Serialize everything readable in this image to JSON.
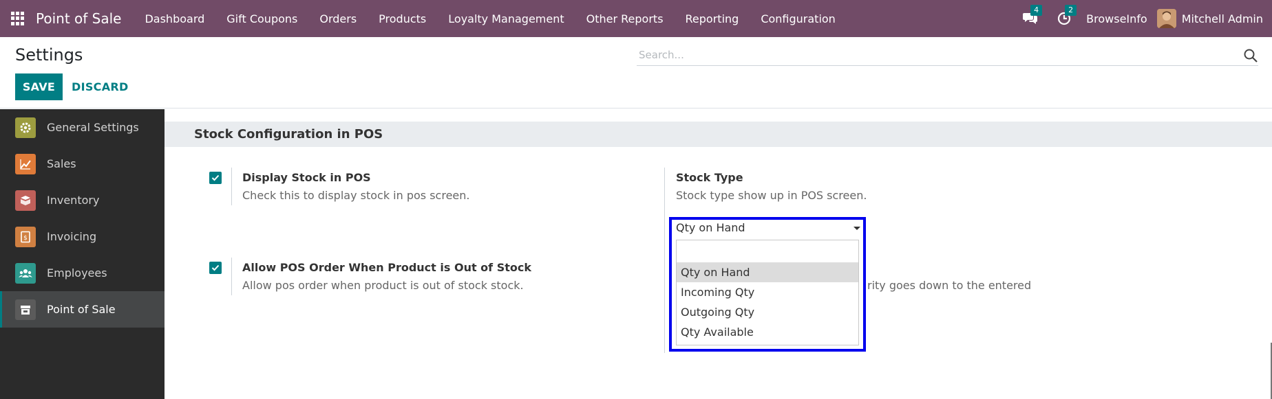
{
  "navbar": {
    "app_name": "Point of Sale",
    "menu": [
      "Dashboard",
      "Gift Coupons",
      "Orders",
      "Products",
      "Loyalty Management",
      "Other Reports",
      "Reporting",
      "Configuration"
    ],
    "messages_count": "4",
    "activities_count": "2",
    "company": "BrowseInfo",
    "user": "Mitchell Admin"
  },
  "control_panel": {
    "title": "Settings",
    "save_label": "SAVE",
    "discard_label": "DISCARD",
    "search_placeholder": "Search..."
  },
  "sidebar": {
    "items": [
      {
        "label": "General Settings",
        "icon": "gear-icon",
        "color": "#9c9c3f"
      },
      {
        "label": "Sales",
        "icon": "chart-icon",
        "color": "#e07b39"
      },
      {
        "label": "Inventory",
        "icon": "box-icon",
        "color": "#c0605a"
      },
      {
        "label": "Invoicing",
        "icon": "invoice-icon",
        "color": "#d08042"
      },
      {
        "label": "Employees",
        "icon": "people-icon",
        "color": "#2e9a8e"
      },
      {
        "label": "Point of Sale",
        "icon": "store-icon",
        "color": "#5b5b5b"
      }
    ],
    "active_index": 5
  },
  "content": {
    "section_title": "Stock Configuration in POS",
    "display_stock": {
      "label": "Display Stock in POS",
      "help": "Check this to display stock in pos screen.",
      "checked": true
    },
    "allow_order": {
      "label": "Allow POS Order When Product is Out of Stock",
      "help": "Allow pos order when product is out of stock stock.",
      "checked": true
    },
    "stock_type": {
      "label": "Stock Type",
      "help": "Stock type show up in POS screen.",
      "value": "Qty on Hand",
      "options": [
        "Qty on Hand",
        "Incoming Qty",
        "Outgoing Qty",
        "Qty Available"
      ],
      "selected_index": 0
    },
    "partial_text": "rity goes down to the entered"
  },
  "colors": {
    "navbar": "#714b67",
    "primary": "#017e84",
    "sidebar": "#2b2b2b",
    "highlight": "#0000ee"
  }
}
